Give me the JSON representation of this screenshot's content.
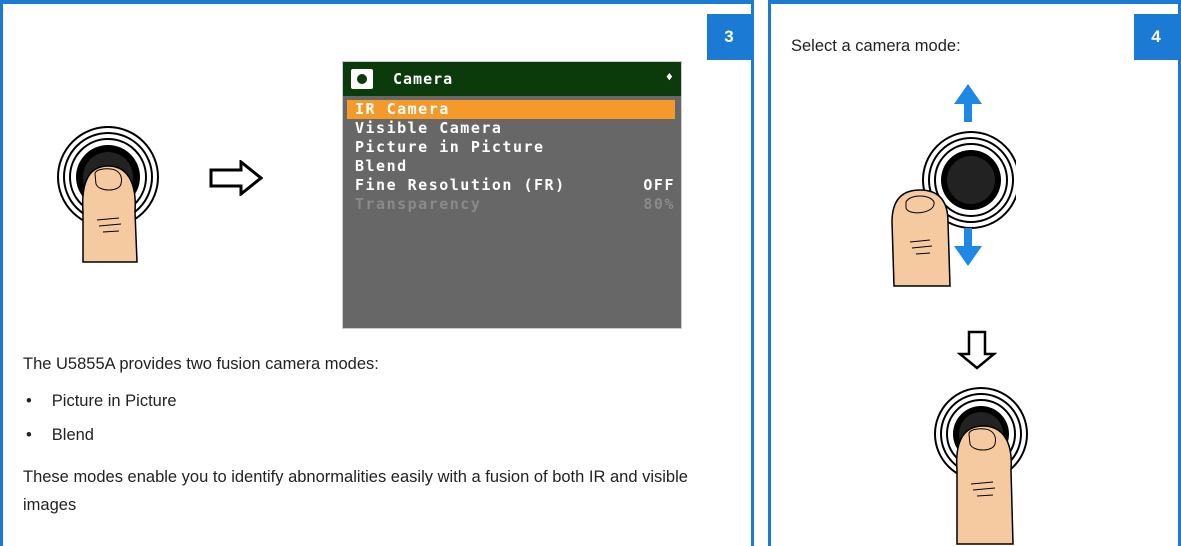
{
  "panels": {
    "left": {
      "step": "3"
    },
    "right": {
      "step": "4",
      "instruction": "Select a camera mode:"
    }
  },
  "screen": {
    "title": "Camera",
    "scroll_glyph": "♦",
    "items": [
      {
        "label": "IR Camera",
        "value": "",
        "selected": true
      },
      {
        "label": "Visible Camera",
        "value": ""
      },
      {
        "label": "Picture in Picture",
        "value": ""
      },
      {
        "label": "Blend",
        "value": ""
      },
      {
        "label": "Fine Resolution (FR)",
        "value": "OFF"
      },
      {
        "label": "Transparency",
        "value": "80%",
        "disabled": true
      }
    ]
  },
  "text": {
    "intro": "The U5855A provides two fusion camera modes:",
    "bullet_char": "•",
    "bullets": [
      "Picture in Picture",
      "Blend"
    ],
    "paragraph": "These modes enable you to identify abnormalities easily with a fusion of both IR and visible images"
  },
  "colors": {
    "accent": "#1b7bd4",
    "selection": "#f39a2a",
    "screen_bg": "#666766",
    "header_bg": "#0b3a0b",
    "arrow_blue": "#1e88e5",
    "skin": "#f6caa0"
  },
  "icons": [
    "press-knob-icon",
    "right-arrow-icon",
    "camera-icon",
    "rotate-knob-icon",
    "up-arrow-icon",
    "down-arrow-icon"
  ]
}
